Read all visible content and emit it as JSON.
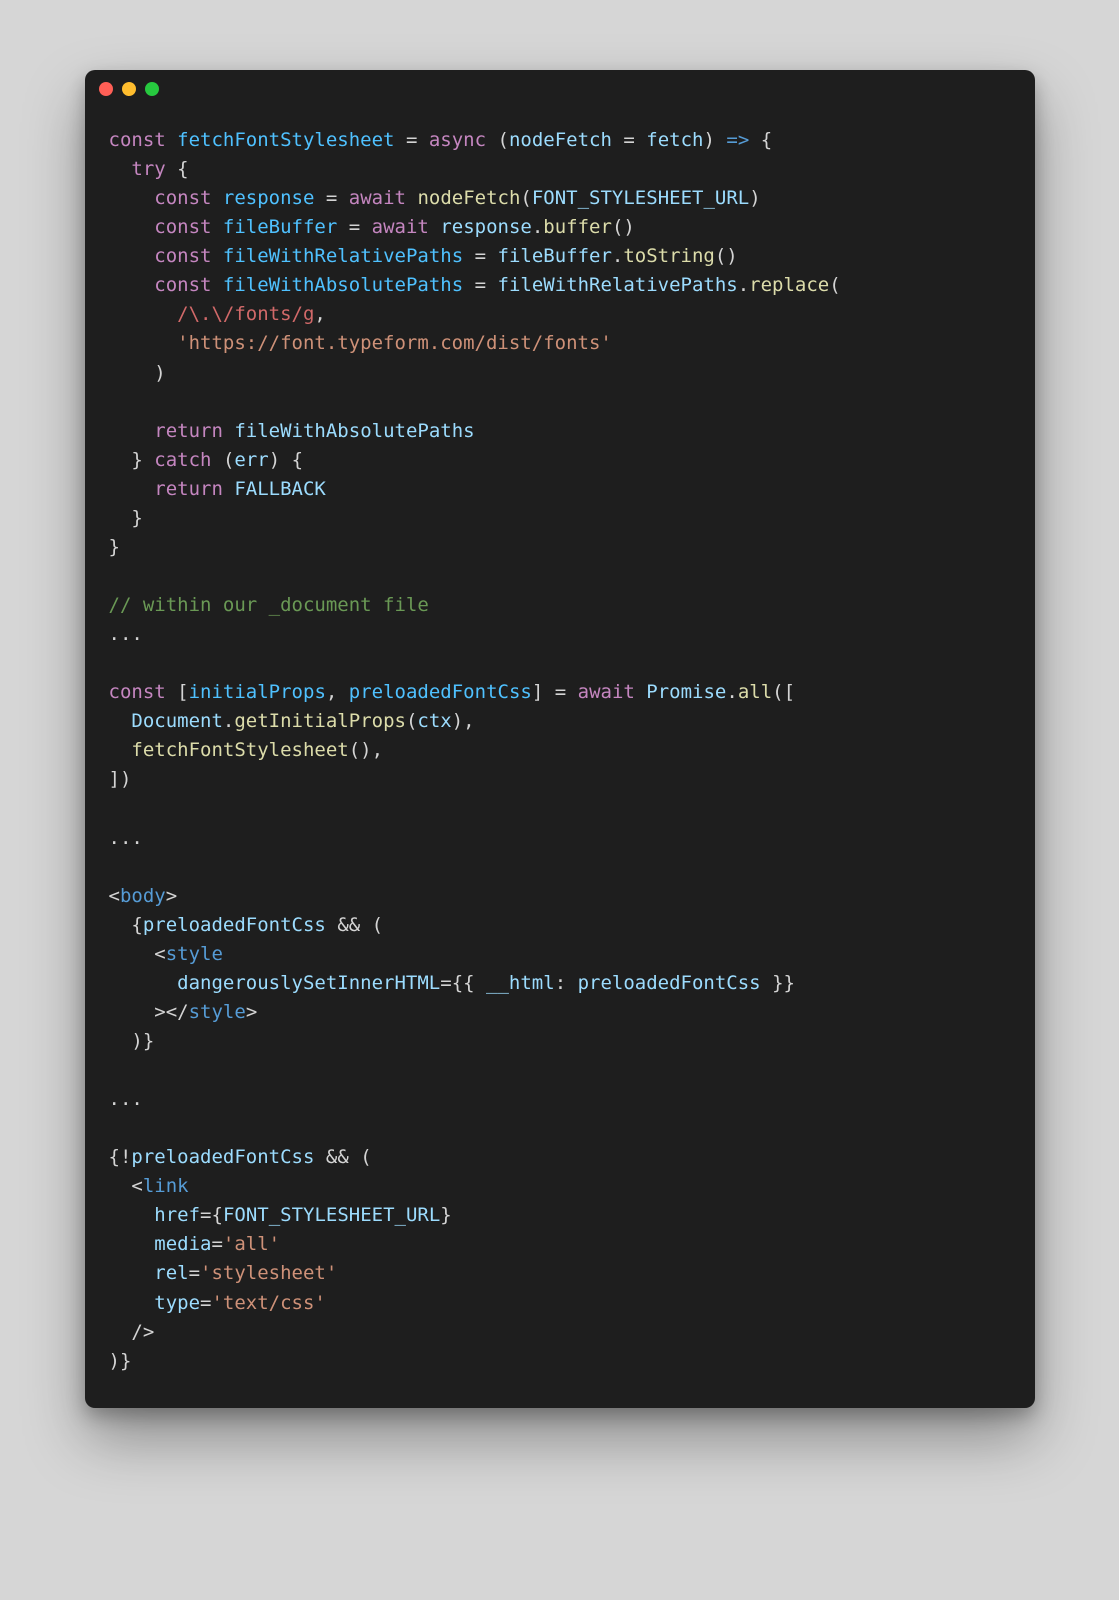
{
  "window": {
    "traffic_lights": [
      "close",
      "minimize",
      "zoom"
    ]
  },
  "code": {
    "language": "javascript",
    "raw": "const fetchFontStylesheet = async (nodeFetch = fetch) => {\n  try {\n    const response = await nodeFetch(FONT_STYLESHEET_URL)\n    const fileBuffer = await response.buffer()\n    const fileWithRelativePaths = fileBuffer.toString()\n    const fileWithAbsolutePaths = fileWithRelativePaths.replace(\n      /\\.\\/fonts/g,\n      'https://font.typeform.com/dist/fonts'\n    )\n\n    return fileWithAbsolutePaths\n  } catch (err) {\n    return FALLBACK\n  }\n}\n\n// within our _document file\n...\n\nconst [initialProps, preloadedFontCss] = await Promise.all([\n  Document.getInitialProps(ctx),\n  fetchFontStylesheet(),\n])\n\n...\n\n<body>\n  {preloadedFontCss && (\n    <style\n      dangerouslySetInnerHTML={{ __html: preloadedFontCss }}\n    ></style>\n  )}\n\n...\n\n{!preloadedFontCss && (\n  <link\n    href={FONT_STYLESHEET_URL}\n    media='all'\n    rel='stylesheet'\n    type='text/css'\n  />\n)}",
    "tokens": [
      [
        [
          "kw",
          "const"
        ],
        [
          "pn",
          " "
        ],
        [
          "cn",
          "fetchFontStylesheet"
        ],
        [
          "pn",
          " "
        ],
        [
          "pn",
          "="
        ],
        [
          "pn",
          " "
        ],
        [
          "kw",
          "async"
        ],
        [
          "pn",
          " "
        ],
        [
          "pn",
          "("
        ],
        [
          "id",
          "nodeFetch"
        ],
        [
          "pn",
          " "
        ],
        [
          "pn",
          "="
        ],
        [
          "pn",
          " "
        ],
        [
          "id",
          "fetch"
        ],
        [
          "pn",
          ")"
        ],
        [
          "pn",
          " "
        ],
        [
          "tg",
          "=>"
        ],
        [
          "pn",
          " "
        ],
        [
          "pn",
          "{"
        ]
      ],
      [
        [
          "pn",
          "  "
        ],
        [
          "kw",
          "try"
        ],
        [
          "pn",
          " "
        ],
        [
          "pn",
          "{"
        ]
      ],
      [
        [
          "pn",
          "    "
        ],
        [
          "kw",
          "const"
        ],
        [
          "pn",
          " "
        ],
        [
          "cn",
          "response"
        ],
        [
          "pn",
          " "
        ],
        [
          "pn",
          "="
        ],
        [
          "pn",
          " "
        ],
        [
          "kw",
          "await"
        ],
        [
          "pn",
          " "
        ],
        [
          "fn",
          "nodeFetch"
        ],
        [
          "pn",
          "("
        ],
        [
          "id",
          "FONT_STYLESHEET_URL"
        ],
        [
          "pn",
          ")"
        ]
      ],
      [
        [
          "pn",
          "    "
        ],
        [
          "kw",
          "const"
        ],
        [
          "pn",
          " "
        ],
        [
          "cn",
          "fileBuffer"
        ],
        [
          "pn",
          " "
        ],
        [
          "pn",
          "="
        ],
        [
          "pn",
          " "
        ],
        [
          "kw",
          "await"
        ],
        [
          "pn",
          " "
        ],
        [
          "id",
          "response"
        ],
        [
          "pn",
          "."
        ],
        [
          "fn",
          "buffer"
        ],
        [
          "pn",
          "()"
        ]
      ],
      [
        [
          "pn",
          "    "
        ],
        [
          "kw",
          "const"
        ],
        [
          "pn",
          " "
        ],
        [
          "cn",
          "fileWithRelativePaths"
        ],
        [
          "pn",
          " "
        ],
        [
          "pn",
          "="
        ],
        [
          "pn",
          " "
        ],
        [
          "id",
          "fileBuffer"
        ],
        [
          "pn",
          "."
        ],
        [
          "fn",
          "toString"
        ],
        [
          "pn",
          "()"
        ]
      ],
      [
        [
          "pn",
          "    "
        ],
        [
          "kw",
          "const"
        ],
        [
          "pn",
          " "
        ],
        [
          "cn",
          "fileWithAbsolutePaths"
        ],
        [
          "pn",
          " "
        ],
        [
          "pn",
          "="
        ],
        [
          "pn",
          " "
        ],
        [
          "id",
          "fileWithRelativePaths"
        ],
        [
          "pn",
          "."
        ],
        [
          "fn",
          "replace"
        ],
        [
          "pn",
          "("
        ]
      ],
      [
        [
          "pn",
          "      "
        ],
        [
          "rx",
          "/\\.\\/fonts/g"
        ],
        [
          "pn",
          ","
        ]
      ],
      [
        [
          "pn",
          "      "
        ],
        [
          "str",
          "'https://font.typeform.com/dist/fonts'"
        ]
      ],
      [
        [
          "pn",
          "    "
        ],
        [
          "pn",
          ")"
        ]
      ],
      [
        [
          "pn",
          ""
        ]
      ],
      [
        [
          "pn",
          "    "
        ],
        [
          "kw",
          "return"
        ],
        [
          "pn",
          " "
        ],
        [
          "id",
          "fileWithAbsolutePaths"
        ]
      ],
      [
        [
          "pn",
          "  "
        ],
        [
          "pn",
          "}"
        ],
        [
          "pn",
          " "
        ],
        [
          "kw",
          "catch"
        ],
        [
          "pn",
          " "
        ],
        [
          "pn",
          "("
        ],
        [
          "id",
          "err"
        ],
        [
          "pn",
          ")"
        ],
        [
          "pn",
          " "
        ],
        [
          "pn",
          "{"
        ]
      ],
      [
        [
          "pn",
          "    "
        ],
        [
          "kw",
          "return"
        ],
        [
          "pn",
          " "
        ],
        [
          "id",
          "FALLBACK"
        ]
      ],
      [
        [
          "pn",
          "  "
        ],
        [
          "pn",
          "}"
        ]
      ],
      [
        [
          "pn",
          "}"
        ]
      ],
      [
        [
          "pn",
          ""
        ]
      ],
      [
        [
          "cm",
          "// within our _document file"
        ]
      ],
      [
        [
          "pn",
          "..."
        ]
      ],
      [
        [
          "pn",
          ""
        ]
      ],
      [
        [
          "kw",
          "const"
        ],
        [
          "pn",
          " "
        ],
        [
          "pn",
          "["
        ],
        [
          "cn",
          "initialProps"
        ],
        [
          "pn",
          ","
        ],
        [
          "pn",
          " "
        ],
        [
          "cn",
          "preloadedFontCss"
        ],
        [
          "pn",
          "]"
        ],
        [
          "pn",
          " "
        ],
        [
          "pn",
          "="
        ],
        [
          "pn",
          " "
        ],
        [
          "kw",
          "await"
        ],
        [
          "pn",
          " "
        ],
        [
          "id",
          "Promise"
        ],
        [
          "pn",
          "."
        ],
        [
          "fn",
          "all"
        ],
        [
          "pn",
          "(["
        ]
      ],
      [
        [
          "pn",
          "  "
        ],
        [
          "id",
          "Document"
        ],
        [
          "pn",
          "."
        ],
        [
          "fn",
          "getInitialProps"
        ],
        [
          "pn",
          "("
        ],
        [
          "id",
          "ctx"
        ],
        [
          "pn",
          "),"
        ]
      ],
      [
        [
          "pn",
          "  "
        ],
        [
          "fn",
          "fetchFontStylesheet"
        ],
        [
          "pn",
          "(),"
        ]
      ],
      [
        [
          "pn",
          "])"
        ]
      ],
      [
        [
          "pn",
          ""
        ]
      ],
      [
        [
          "pn",
          "..."
        ]
      ],
      [
        [
          "pn",
          ""
        ]
      ],
      [
        [
          "pn",
          "<"
        ],
        [
          "tg",
          "body"
        ],
        [
          "pn",
          ">"
        ]
      ],
      [
        [
          "pn",
          "  "
        ],
        [
          "pn",
          "{"
        ],
        [
          "id",
          "preloadedFontCss"
        ],
        [
          "pn",
          " "
        ],
        [
          "pn",
          "&&"
        ],
        [
          "pn",
          " "
        ],
        [
          "pn",
          "("
        ]
      ],
      [
        [
          "pn",
          "    "
        ],
        [
          "pn",
          "<"
        ],
        [
          "tg",
          "style"
        ]
      ],
      [
        [
          "pn",
          "      "
        ],
        [
          "at",
          "dangerouslySetInnerHTML"
        ],
        [
          "pn",
          "="
        ],
        [
          "pn",
          "{{"
        ],
        [
          "pn",
          " "
        ],
        [
          "id",
          "__html"
        ],
        [
          "pn",
          ":"
        ],
        [
          "pn",
          " "
        ],
        [
          "id",
          "preloadedFontCss"
        ],
        [
          "pn",
          " "
        ],
        [
          "pn",
          "}}"
        ]
      ],
      [
        [
          "pn",
          "    "
        ],
        [
          "pn",
          ">"
        ],
        [
          "pn",
          "</"
        ],
        [
          "tg",
          "style"
        ],
        [
          "pn",
          ">"
        ]
      ],
      [
        [
          "pn",
          "  "
        ],
        [
          "pn",
          ")}"
        ]
      ],
      [
        [
          "pn",
          ""
        ]
      ],
      [
        [
          "pn",
          "..."
        ]
      ],
      [
        [
          "pn",
          ""
        ]
      ],
      [
        [
          "pn",
          "{"
        ],
        [
          "pn",
          "!"
        ],
        [
          "id",
          "preloadedFontCss"
        ],
        [
          "pn",
          " "
        ],
        [
          "pn",
          "&&"
        ],
        [
          "pn",
          " "
        ],
        [
          "pn",
          "("
        ]
      ],
      [
        [
          "pn",
          "  "
        ],
        [
          "pn",
          "<"
        ],
        [
          "tg",
          "link"
        ]
      ],
      [
        [
          "pn",
          "    "
        ],
        [
          "at",
          "href"
        ],
        [
          "pn",
          "="
        ],
        [
          "pn",
          "{"
        ],
        [
          "id",
          "FONT_STYLESHEET_URL"
        ],
        [
          "pn",
          "}"
        ]
      ],
      [
        [
          "pn",
          "    "
        ],
        [
          "at",
          "media"
        ],
        [
          "pn",
          "="
        ],
        [
          "str",
          "'all'"
        ]
      ],
      [
        [
          "pn",
          "    "
        ],
        [
          "at",
          "rel"
        ],
        [
          "pn",
          "="
        ],
        [
          "str",
          "'stylesheet'"
        ]
      ],
      [
        [
          "pn",
          "    "
        ],
        [
          "at",
          "type"
        ],
        [
          "pn",
          "="
        ],
        [
          "str",
          "'text/css'"
        ]
      ],
      [
        [
          "pn",
          "  "
        ],
        [
          "pn",
          "/>"
        ]
      ],
      [
        [
          "pn",
          ")}"
        ]
      ]
    ]
  }
}
